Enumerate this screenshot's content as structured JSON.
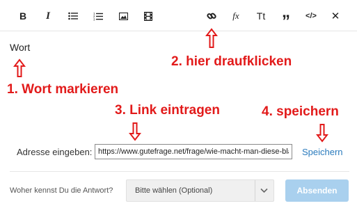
{
  "toolbar": {
    "items": [
      {
        "name": "bold",
        "label": "B"
      },
      {
        "name": "italic",
        "label": "I"
      },
      {
        "name": "bullet-list",
        "icon": "bullet-list-icon"
      },
      {
        "name": "numbered-list",
        "icon": "numbered-list-icon"
      },
      {
        "name": "image",
        "icon": "image-icon"
      },
      {
        "name": "video",
        "icon": "film-icon"
      },
      {
        "name": "link",
        "icon": "link-icon"
      },
      {
        "name": "formula",
        "label": "fx"
      },
      {
        "name": "text-size",
        "label": "Tt"
      },
      {
        "name": "quote",
        "label": "”"
      },
      {
        "name": "code",
        "label": "</>"
      },
      {
        "name": "close",
        "label": "✕"
      }
    ]
  },
  "editor": {
    "word": "Wort"
  },
  "annotations": {
    "step1": "1. Wort markieren",
    "step2": "2. hier draufklicken",
    "step3": "3. Link eintragen",
    "step4": "4. speichern",
    "color": "#e21a1a"
  },
  "link_form": {
    "label": "Adresse eingeben:",
    "url_value": "https://www.gutefrage.net/frage/wie-macht-man-diese-blau",
    "save_label": "Speichern"
  },
  "footer": {
    "source_label": "Woher kennst Du die Antwort?",
    "select_value": "Bitte wählen (Optional)",
    "submit_label": "Absenden"
  },
  "colors": {
    "accent": "#2a7bbd",
    "submit_bg": "#a9d0ee",
    "annotation": "#e21a1a"
  }
}
